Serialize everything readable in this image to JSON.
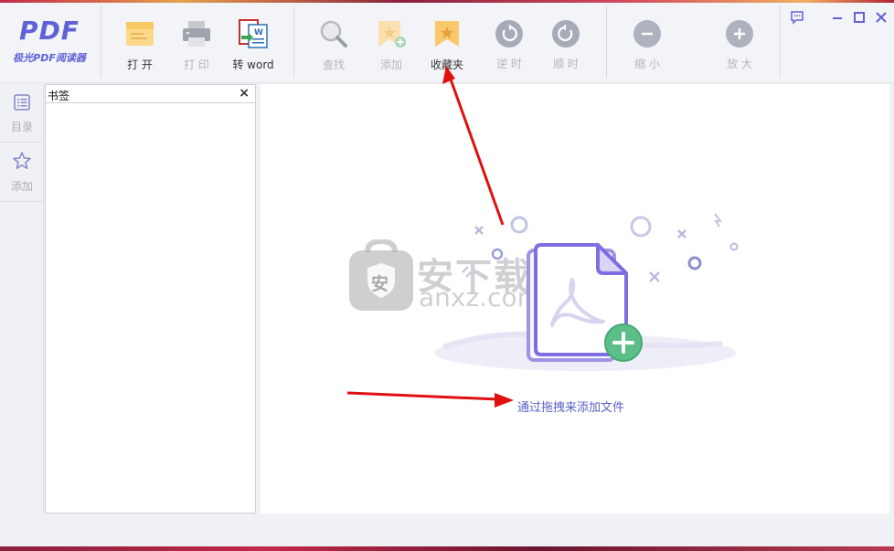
{
  "app": {
    "logo_text": "PDF",
    "logo_subtitle": "极光PDF阅读器"
  },
  "toolbar": {
    "open_label": "打 开",
    "print_label": "打 印",
    "to_word_label": "转 word",
    "find_label": "查找",
    "add_label": "添加",
    "favorites_label": "收藏夹",
    "ccw_label": "逆 时",
    "cw_label": "顺 时",
    "zoom_out_label": "缩 小",
    "zoom_in_label": "放 大"
  },
  "sidebar": {
    "toc_label": "目录",
    "add_bookmark_label": "添加"
  },
  "bookmark_panel": {
    "title": "书签",
    "close_glyph": "×"
  },
  "main": {
    "drop_hint": "通过拖拽来添加文件"
  },
  "watermark": {
    "text": "安下载",
    "sub": "anxz.com",
    "badge": "安"
  },
  "colors": {
    "accent": "#6161d8",
    "doc_stroke": "#7e6ee0",
    "plus_green": "#5cbf8a",
    "arrow_red": "#e01010"
  }
}
